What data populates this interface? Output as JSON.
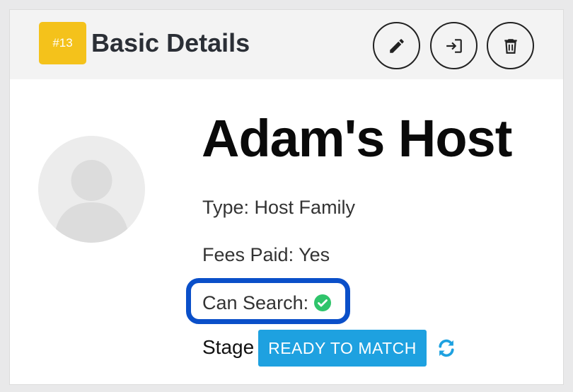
{
  "header": {
    "badge": "#13",
    "title": "Basic Details",
    "actions": [
      {
        "name": "edit",
        "icon": "pencil-icon"
      },
      {
        "name": "login",
        "icon": "sign-in-icon"
      },
      {
        "name": "delete",
        "icon": "trash-icon"
      }
    ]
  },
  "profile": {
    "name": "Adam's Host",
    "type_label": "Type: Host Family",
    "fees_label": "Fees Paid: Yes",
    "can_search_label": "Can Search:",
    "can_search_status_icon": "check-circle-icon",
    "stage_label": "Stage",
    "stage_value": "READY TO MATCH",
    "refresh_icon": "refresh-icon"
  },
  "colors": {
    "badge": "#f4c21b",
    "stage_button": "#1ea1e0",
    "highlight_border": "#0a4fc9",
    "check_green": "#2fc46b"
  }
}
